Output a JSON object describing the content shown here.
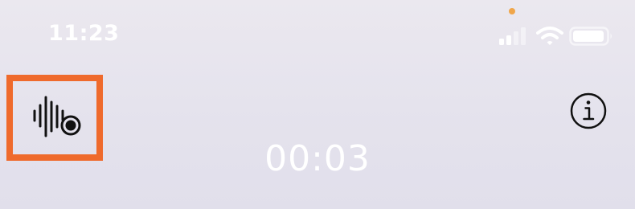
{
  "status_bar": {
    "time": "11:23",
    "privacy_indicator_color": "#f0a64a",
    "signal_icon": "cellular-signal-icon",
    "wifi_icon": "wifi-icon",
    "battery_icon": "battery-icon",
    "signal_bars_filled": 2,
    "signal_bars_total": 4
  },
  "toolbar": {
    "record_icon": "waveform-record-icon",
    "info_icon": "info-icon",
    "highlight_color": "#ef6a2c"
  },
  "recording": {
    "elapsed_time": "00:03"
  }
}
